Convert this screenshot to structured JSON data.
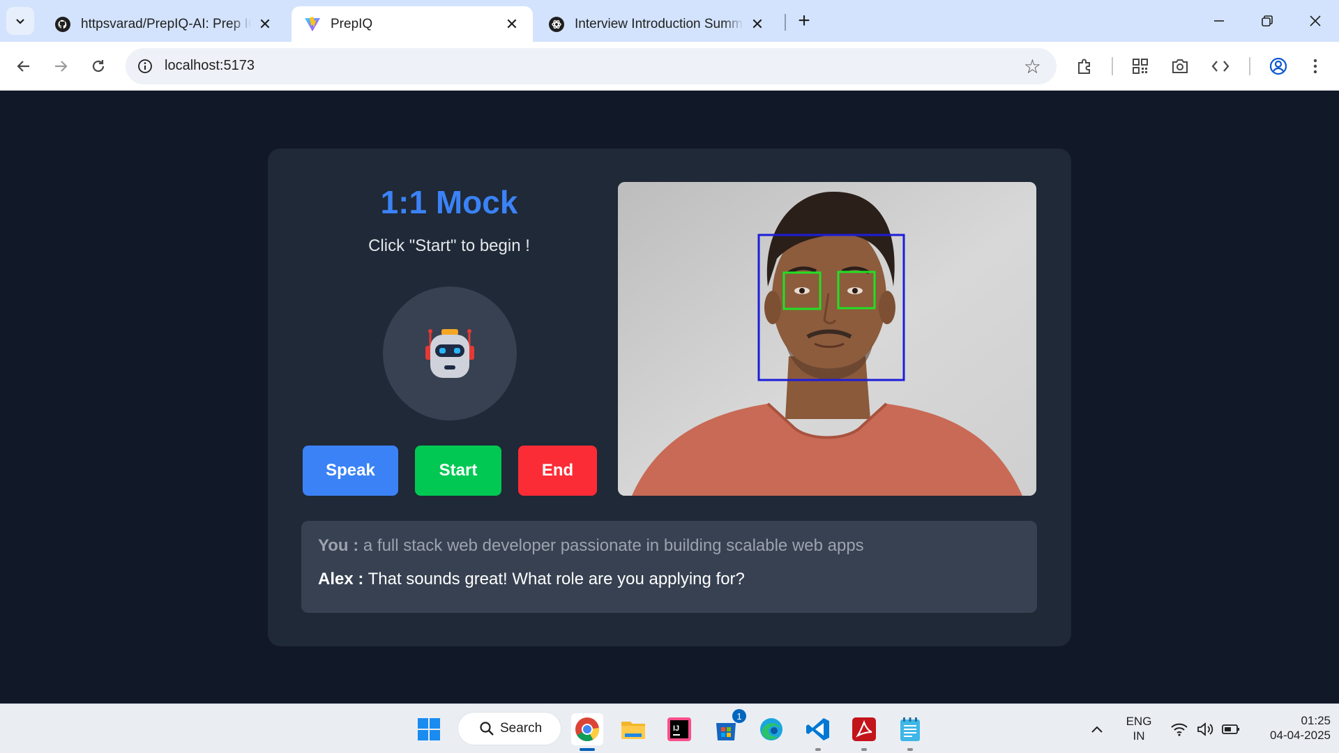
{
  "browser": {
    "tabs": [
      {
        "title": "httpsvarad/PrepIQ-AI: Prep IQ i",
        "icon": "github-icon",
        "active": false
      },
      {
        "title": "PrepIQ",
        "icon": "vite-icon",
        "active": true
      },
      {
        "title": "Interview Introduction Summary",
        "icon": "chatgpt-icon",
        "active": false
      }
    ],
    "url": "localhost:5173"
  },
  "app": {
    "title": "1:1 Mock",
    "subtitle": "Click \"Start\" to begin !",
    "buttons": {
      "speak": "Speak",
      "start": "Start",
      "end": "End"
    },
    "transcript": {
      "you_label": "You :",
      "you_text": "a full stack web developer passionate in building scalable web apps",
      "alex_label": "Alex :",
      "alex_text": "That sounds great! What role are you applying for?"
    },
    "colors": {
      "accent": "#3b82f6",
      "speak": "#3b82f6",
      "start": "#00c853",
      "end": "#fb2c36",
      "face_box": "#1d1dd8",
      "eye_box": "#22e022"
    }
  },
  "taskbar": {
    "search_label": "Search",
    "store_badge": "1",
    "lang_line1": "ENG",
    "lang_line2": "IN",
    "time": "01:25",
    "date": "04-04-2025"
  }
}
